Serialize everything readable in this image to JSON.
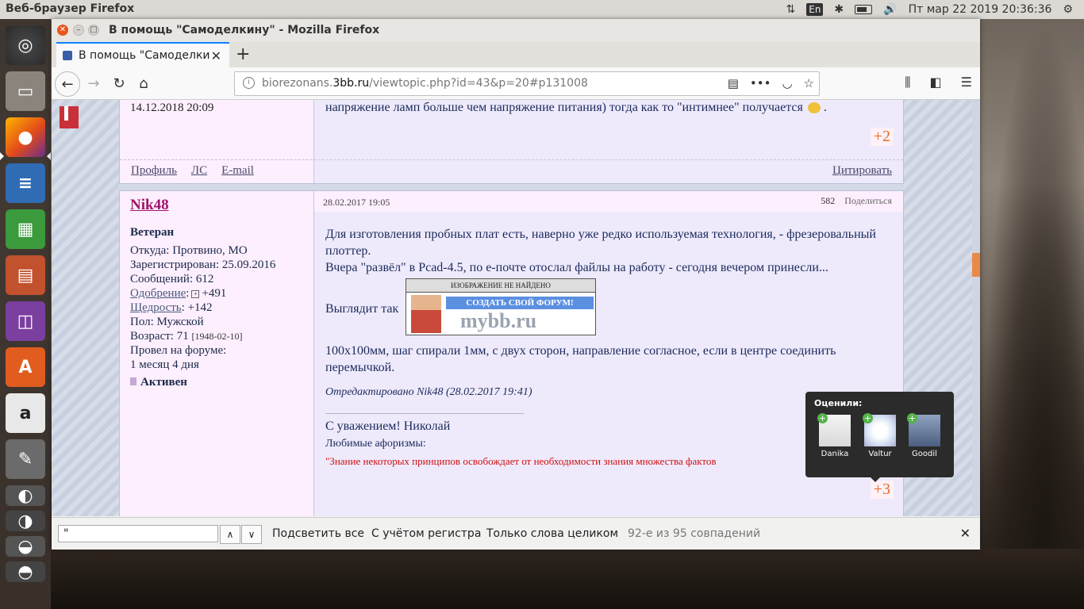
{
  "top_panel": {
    "app_title": "Веб-браузер Firefox",
    "keyboard": "En",
    "datetime": "Пт мар 22 2019 20:36:36",
    "icons": [
      "network-icon",
      "bluetooth-icon",
      "battery-icon",
      "volume-icon",
      "power-icon"
    ]
  },
  "launcher": {
    "items": [
      "ubuntu-dash",
      "files",
      "firefox",
      "libreoffice-writer",
      "libreoffice-calc",
      "libreoffice-impress",
      "libreoffice-base",
      "ubuntu-software",
      "amazon",
      "system-settings"
    ]
  },
  "window": {
    "title": "В помощь \"Самоделкину\" - Mozilla Firefox",
    "tab_label": "В помощь \"Самоделкин",
    "url_domain_prefix": "biorezonans.",
    "url_domain": "3bb.ru",
    "url_path": "/viewtopic.php?id=43&p=20#p131008"
  },
  "post1": {
    "date": "14.12.2018 20:09",
    "text": "напряжение ламп больше чем напряжение питания) тогда как то \"интимнее\" получается",
    "text_end": ".",
    "rating": "+2",
    "links": [
      "Профиль",
      "ЛС",
      "E-mail"
    ],
    "quote": "Цитировать"
  },
  "post2": {
    "date": "28.02.2017 19:05",
    "number": "582",
    "share": "Поделиться",
    "author": "Nik48",
    "rank": "Ветеран",
    "from": "Откуда: Протвино, МО",
    "registered": "Зарегистрирован: 25.09.2016",
    "messages": "Сообщений: 612",
    "approval_label": "Одобрение",
    "approval_value": "+491",
    "generosity_label": "Щедрость",
    "generosity_value": ": +142",
    "gender": "Пол: Мужской",
    "age": "Возраст: 71",
    "birth": "[1948-02-10]",
    "time_on_forum_1": "Провел на форуме:",
    "time_on_forum_2": "1 месяц 4 дня",
    "status": "Активен",
    "body_1": "Для изготовления пробных плат есть, наверно уже редко используемая технология, - фрезеровальный плоттер.",
    "body_2": "Вчера \"развёл\" в Pcad-4.5, по е-почте отослал файлы на работу - сегодня вечером принесли...",
    "body_3": "Выглядит так",
    "body_4": "100х100мм, шаг спирали 1мм, с двух сторон, направление согласное, если в центре соединить перемычкой.",
    "image_missing": "ИЗОБРАЖЕНИЕ НЕ НАЙДЕНО",
    "image_banner": "СОЗДАТЬ СВОЙ ФОРУМ!",
    "image_logo": "mybb.ru",
    "edited": "Отредактировано Nik48 (28.02.2017 19:41)",
    "sig_1": "С уважением! Николай",
    "sig_2": "Любимые афоризмы:",
    "sig_3": "\"Знание некоторых принципов освобождает от необходимости знания множества фактов",
    "rating": "+3",
    "rated_title": "Оценили:",
    "raters": [
      "Danika",
      "Valtur",
      "Goodil"
    ]
  },
  "findbar": {
    "input_value": "\"",
    "highlight_all": "Подсветить все",
    "match_case": "С учётом регистра",
    "whole_words": "Только слова целиком",
    "status": "92-е из 95 совпадений"
  }
}
